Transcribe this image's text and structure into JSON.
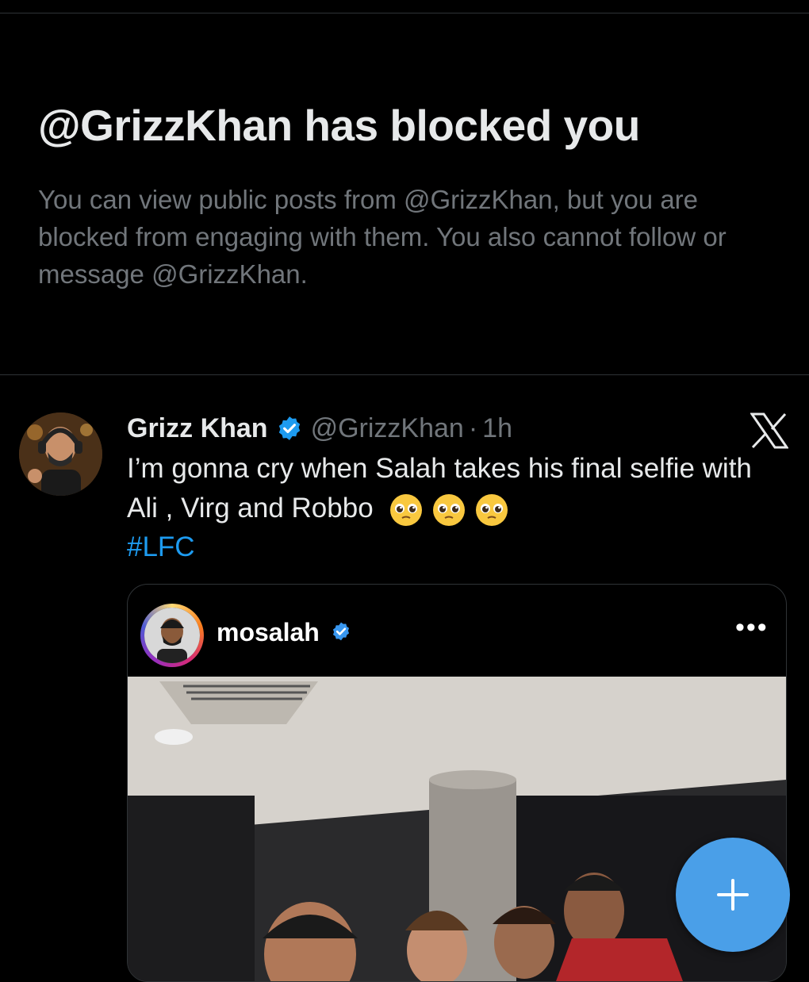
{
  "block_notice": {
    "title": "@GrizzKhan has blocked you",
    "description": "You can view public posts from @GrizzKhan, but you are blocked from engaging with them. You also cannot follow or message @GrizzKhan."
  },
  "post": {
    "author_name": "Grizz Khan",
    "handle": "@GrizzKhan",
    "separator": "·",
    "time": "1h",
    "text": "I’m gonna cry when Salah takes his final selfie with Ali , Virg and Robbo",
    "emojis": [
      "pleading-face",
      "pleading-face",
      "pleading-face"
    ],
    "hashtag": "#LFC",
    "verified_color": "#1d9bf0"
  },
  "embedded_media": {
    "username": "mosalah",
    "more": "•••"
  },
  "fab": {
    "icon": "plus-icon",
    "color": "#4a9fe8"
  },
  "colors": {
    "background": "#000000",
    "secondary_text": "#71767b",
    "link": "#1d9bf0"
  }
}
